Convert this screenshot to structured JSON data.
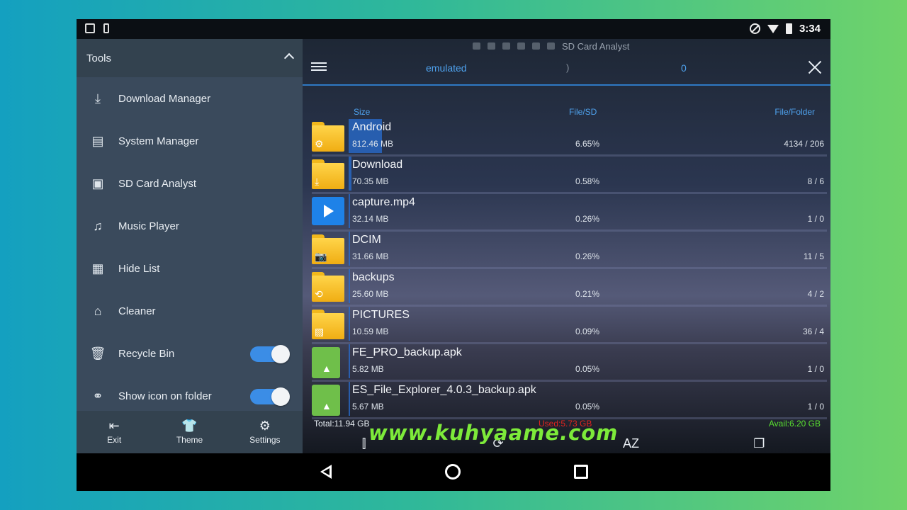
{
  "status_bar": {
    "time": "3:34"
  },
  "drawer": {
    "header": "Tools",
    "items": [
      {
        "label": "Download Manager",
        "icon": "download-icon",
        "glyph": "⤓"
      },
      {
        "label": "System Manager",
        "icon": "system-manager-icon",
        "glyph": "▤"
      },
      {
        "label": "SD Card Analyst",
        "icon": "sd-card-analyst-icon",
        "glyph": "▣"
      },
      {
        "label": "Music Player",
        "icon": "headphones-icon",
        "glyph": "♫"
      },
      {
        "label": "Hide List",
        "icon": "hide-list-icon",
        "glyph": "▦"
      },
      {
        "label": "Cleaner",
        "icon": "cleaner-icon",
        "glyph": "⌂"
      },
      {
        "label": "Recycle Bin",
        "icon": "recycle-bin-icon",
        "glyph": "🗑",
        "toggle": true
      },
      {
        "label": "Show icon on folder",
        "icon": "link-icon",
        "glyph": "⚭",
        "toggle": true
      }
    ],
    "bottom": [
      {
        "label": "Exit",
        "glyph": "⇤"
      },
      {
        "label": "Theme",
        "glyph": "👕"
      },
      {
        "label": "Settings",
        "glyph": "⚙"
      }
    ]
  },
  "main": {
    "app_title": "SD Card Analyst",
    "path": {
      "segment": "emulated",
      "separator": ")",
      "count": "0"
    },
    "columns": {
      "size": "Size",
      "file_sd": "File/SD",
      "file_folder": "File/Folder"
    },
    "files": [
      {
        "name": "Android",
        "size": "812.46 MB",
        "pct": "6.65%",
        "count": "4134 / 206",
        "type": "folder",
        "badge": "⚙",
        "share": 0.0665
      },
      {
        "name": "Download",
        "size": "70.35 MB",
        "pct": "0.58%",
        "count": "8 / 6",
        "type": "folder",
        "badge": "⤓",
        "share": 0.0058
      },
      {
        "name": "capture.mp4",
        "size": "32.14 MB",
        "pct": "0.26%",
        "count": "1 / 0",
        "type": "video",
        "badge": "",
        "share": 0.0026
      },
      {
        "name": "DCIM",
        "size": "31.66 MB",
        "pct": "0.26%",
        "count": "11 / 5",
        "type": "folder",
        "badge": "📷",
        "share": 0.0026
      },
      {
        "name": "backups",
        "size": "25.60 MB",
        "pct": "0.21%",
        "count": "4 / 2",
        "type": "folder",
        "badge": "⟲",
        "share": 0.0021
      },
      {
        "name": "PICTURES",
        "size": "10.59 MB",
        "pct": "0.09%",
        "count": "36 / 4",
        "type": "folder",
        "badge": "▨",
        "share": 0.0009
      },
      {
        "name": "FE_PRO_backup.apk",
        "size": "5.82 MB",
        "pct": "0.05%",
        "count": "1 / 0",
        "type": "apk",
        "badge": "",
        "share": 0.0005
      },
      {
        "name": "ES_File_Explorer_4.0.3_backup.apk",
        "size": "5.67 MB",
        "pct": "0.05%",
        "count": "1 / 0",
        "type": "apk",
        "badge": "",
        "share": 0.0005
      }
    ],
    "summary": {
      "total": "Total:11.94 GB",
      "used": "Used:5.73 GB",
      "avail": "Avail:6.20 GB"
    },
    "bottom": [
      {
        "label": "Directory Analyze",
        "glyph": "⫿"
      },
      {
        "label": "Refresh",
        "glyph": "⟳"
      },
      {
        "label": "Sort",
        "glyph": "AZ"
      },
      {
        "label": "Windows",
        "glyph": "❐"
      }
    ]
  },
  "watermark": "www.kuhyaame.com"
}
